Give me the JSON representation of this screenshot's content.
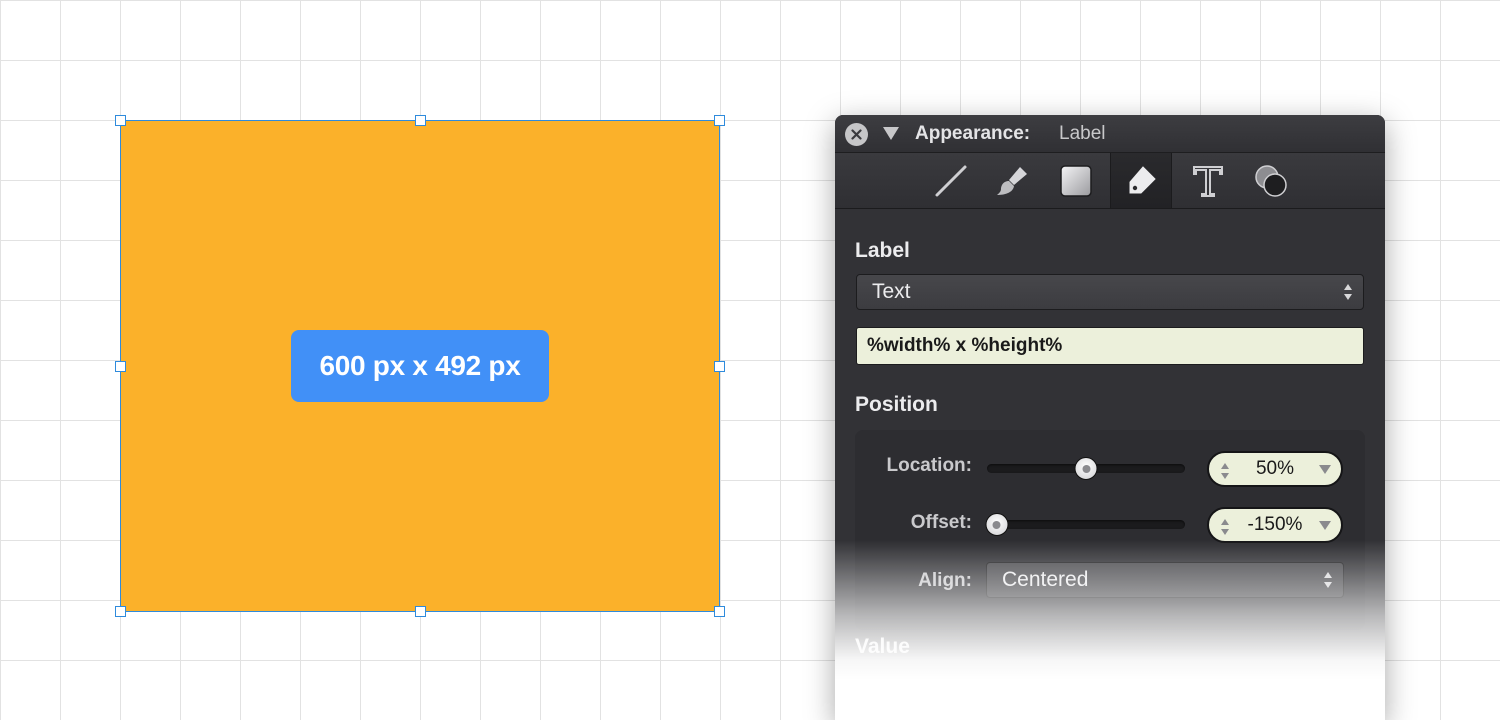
{
  "canvas": {
    "shape_fill": "#fbb12a",
    "selection_color": "#2f8bdc",
    "label_text": "600 px x 492 px",
    "label_bg": "#4190f7"
  },
  "inspector": {
    "title": "Appearance:",
    "subtitle": "Label",
    "toolbar": [
      {
        "icon": "line-icon"
      },
      {
        "icon": "brush-icon"
      },
      {
        "icon": "fill-square-icon"
      },
      {
        "icon": "label-tag-icon",
        "active": true
      },
      {
        "icon": "text-icon"
      },
      {
        "icon": "shadow-circles-icon"
      }
    ],
    "label_section": {
      "heading": "Label",
      "type_select": "Text",
      "text_value": "%width% x %height%"
    },
    "position_section": {
      "heading": "Position",
      "location": {
        "label": "Location:",
        "value": "50%",
        "slider_level": 0.5
      },
      "offset": {
        "label": "Offset:",
        "value": "-150%",
        "slider_level": 0.05
      },
      "align": {
        "label": "Align:",
        "value": "Centered"
      }
    },
    "value_section": {
      "heading": "Value"
    }
  }
}
